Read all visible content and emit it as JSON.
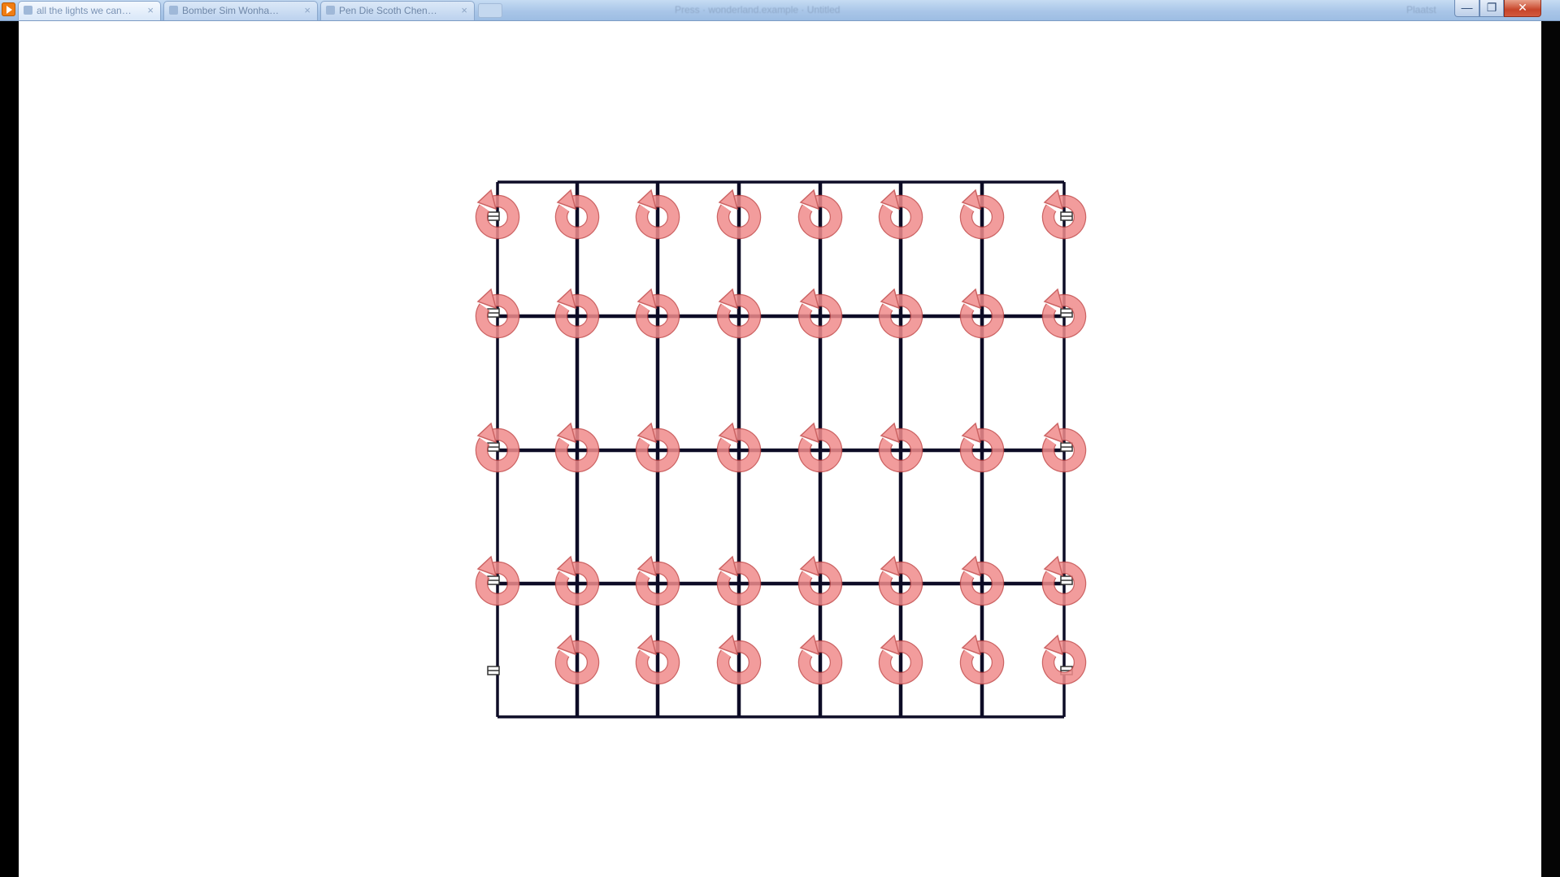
{
  "window": {
    "tabs": [
      {
        "label": "all the lights we can…",
        "active": true
      },
      {
        "label": "Bomber Sim Wonha…",
        "active": false
      },
      {
        "label": "Pen Die Scoth Chen…",
        "active": false
      }
    ],
    "tab_close_glyph": "×",
    "url_text": "Press · wonderland.example · Untitled",
    "right_label": "Plaatst",
    "controls": {
      "minimize": "—",
      "maximize": "❐",
      "close": "✕"
    }
  },
  "canvas": {
    "background": "#ffffff",
    "grid": {
      "columns": 8,
      "rows": 5,
      "line_color": "#0d0c26",
      "restart_icon_color": "#f08b8b",
      "restart_icon_outline": "#c44a4a",
      "row_icon_counts": [
        8,
        8,
        8,
        8,
        7
      ]
    },
    "icon": "restart-circle-arrow-icon"
  }
}
